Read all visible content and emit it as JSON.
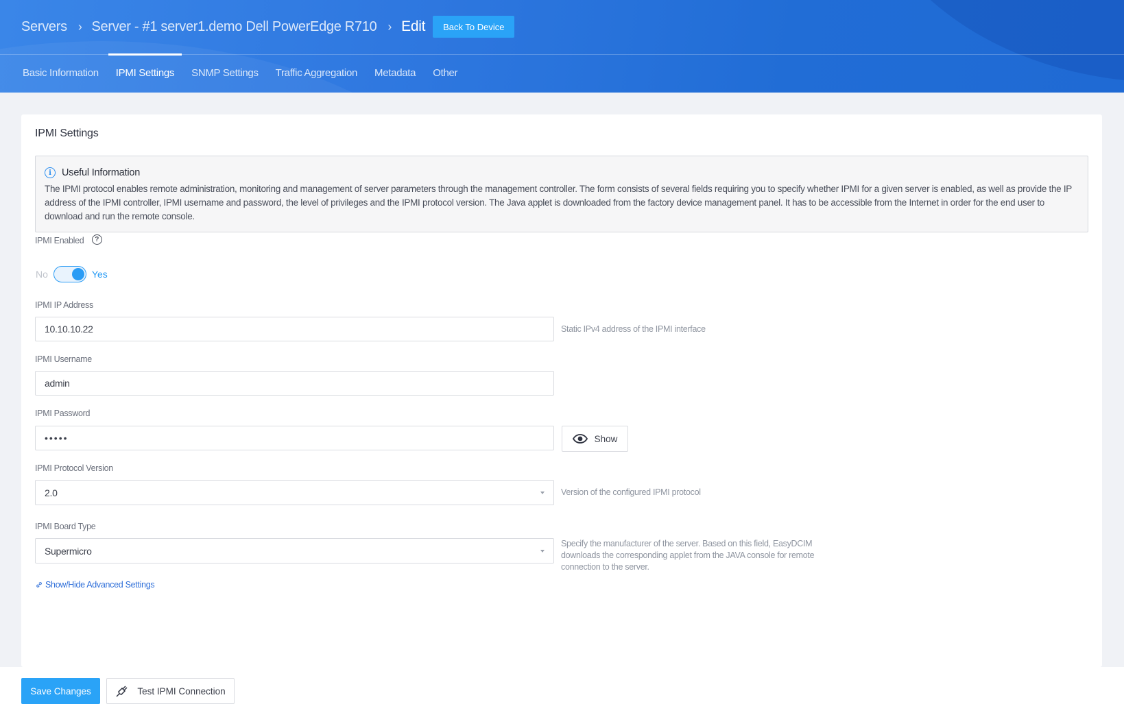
{
  "header": {
    "breadcrumb": [
      "Servers",
      "Server - #1 server1.demo Dell PowerEdge R710",
      "Edit"
    ],
    "separator": ">",
    "back_button": "Back To Device",
    "tabs": [
      {
        "label": "Basic Information",
        "active": false
      },
      {
        "label": "IPMI Settings",
        "active": true
      },
      {
        "label": "SNMP Settings",
        "active": false
      },
      {
        "label": "Traffic Aggregation",
        "active": false
      },
      {
        "label": "Metadata",
        "active": false
      },
      {
        "label": "Other",
        "active": false
      }
    ]
  },
  "card": {
    "title": "IPMI Settings",
    "info": {
      "icon": "info-icon",
      "title": "Useful Information",
      "text": "The IPMI protocol enables remote administration, monitoring and management of server parameters through the management controller. The form consists of several fields requiring you to specify whether IPMI for a given server is enabled, as well as provide the IP address of the IPMI controller, IPMI username and password, the level of privileges and the IPMI protocol version. The Java applet is downloaded from the factory device management panel. It has to be accessible from the Internet in order for the end user to download and run the remote console."
    },
    "ipmi_enabled": {
      "label": "IPMI Enabled",
      "help_icon": "question-circle-icon",
      "off_label": "No",
      "on_label": "Yes",
      "value": true
    },
    "ip_address": {
      "label": "IPMI IP Address",
      "value": "10.10.10.22",
      "hint": "Static IPv4 address of the IPMI interface"
    },
    "username": {
      "label": "IPMI Username",
      "value": "admin"
    },
    "password": {
      "label": "IPMI Password",
      "value": "•••••",
      "show_button": "Show",
      "show_icon": "eye-icon"
    },
    "protocol_version": {
      "label": "IPMI Protocol Version",
      "value": "2.0",
      "hint": "Version of the configured IPMI protocol"
    },
    "board_type": {
      "label": "IPMI Board Type",
      "value": "Supermicro",
      "hint": "Specify the manufacturer of the server. Based on this field, EasyDCIM downloads the corresponding applet from the JAVA console for remote connection to the server."
    },
    "advanced_link": "Show/Hide Advanced Settings"
  },
  "footer": {
    "save_button": "Save Changes",
    "test_button": "Test IPMI Connection",
    "test_icon": "plug-icon"
  },
  "colors": {
    "header_blue": "#2f78e0",
    "accent": "#2aa3f7",
    "link": "#2f6fd9"
  }
}
